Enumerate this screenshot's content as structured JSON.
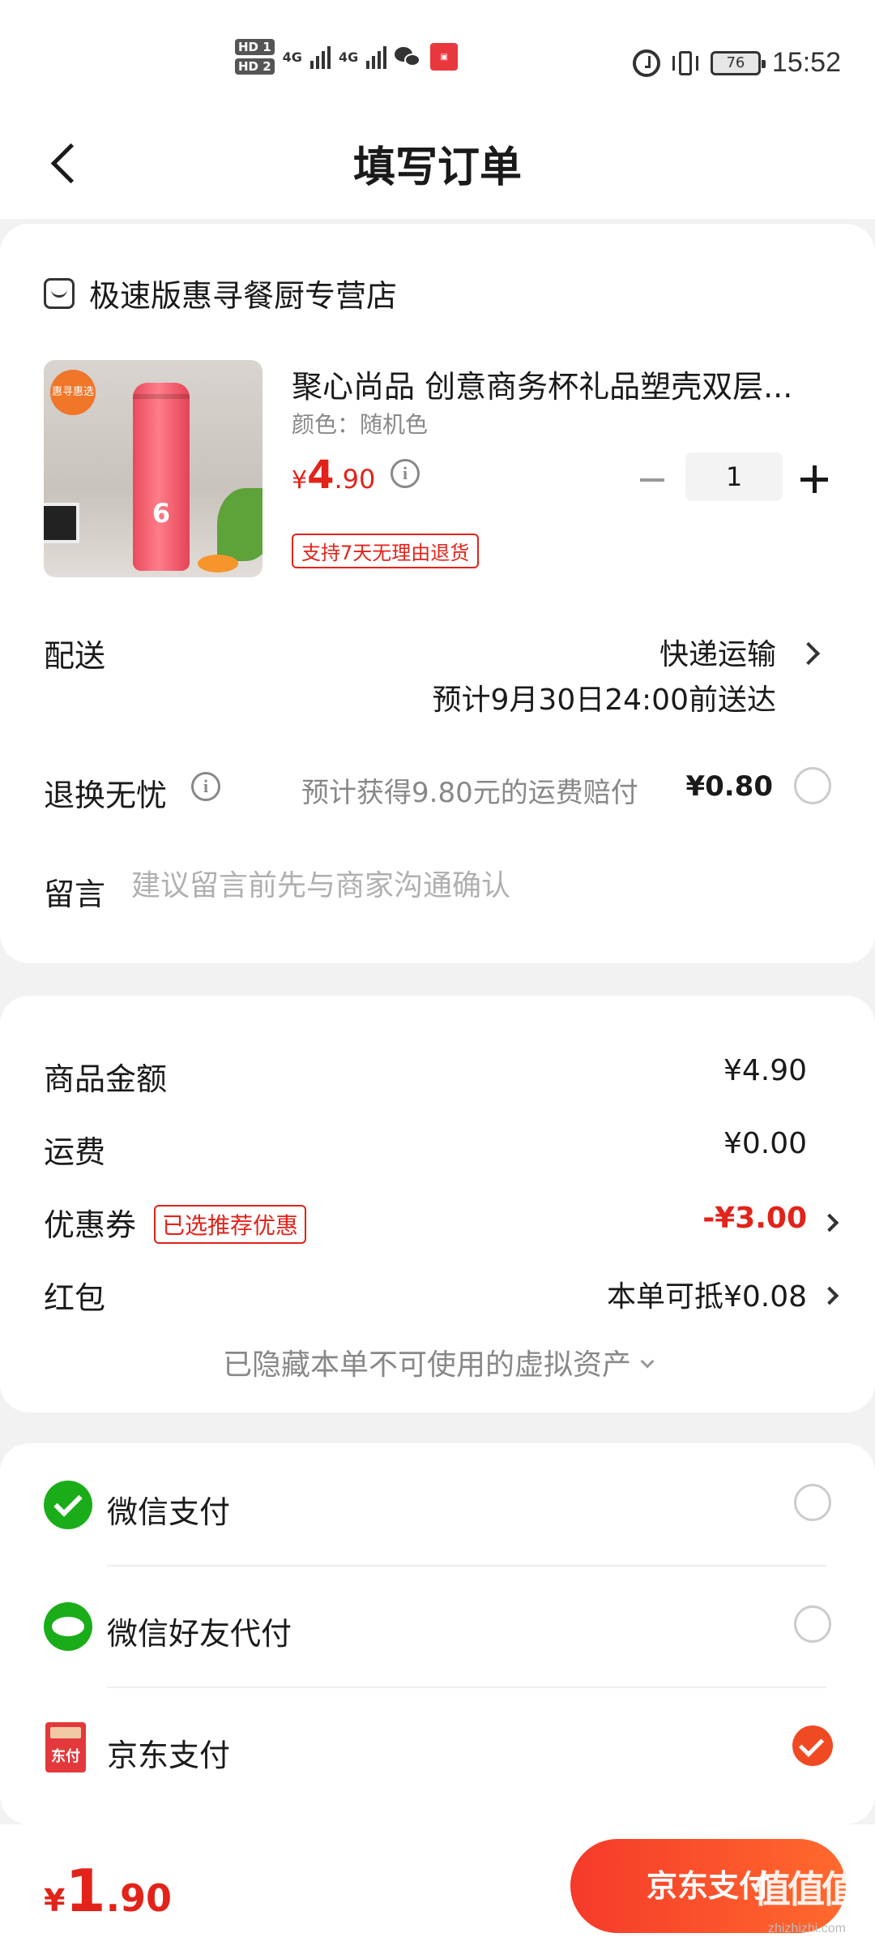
{
  "status_bar": {
    "hd1": "HD 1",
    "hd2": "HD 2",
    "net1": "4G",
    "net2": "4G",
    "battery": "76",
    "time": "15:52"
  },
  "header": {
    "title": "填写订单",
    "back_icon": "chevron-left-icon"
  },
  "store": {
    "name": "极速版惠寻餐厨专营店"
  },
  "product": {
    "title": "聚心尚品 创意商务杯礼品塑壳双层...",
    "variant": "颜色：随机色",
    "price_currency": "¥",
    "price_int": "4",
    "price_dec": ".90",
    "image_badge": "惠寻惠选",
    "quantity": "1",
    "return_policy": "支持7天无理由退货"
  },
  "shipping": {
    "label": "配送",
    "method": "快递运输",
    "eta": "预计9月30日24:00前送达"
  },
  "insurance": {
    "label": "退换无忧",
    "description": "预计获得9.80元的运费赔付",
    "price": "¥0.80",
    "checked": false
  },
  "message": {
    "label": "留言",
    "placeholder": "建议留言前先与商家沟通确认"
  },
  "summary": {
    "goods_label": "商品金额",
    "goods_value": "¥4.90",
    "shipping_label": "运费",
    "shipping_value": "¥0.00",
    "coupon_label": "优惠券",
    "coupon_tag": "已选推荐优惠",
    "coupon_value": "-¥3.00",
    "redpacket_label": "红包",
    "redpacket_value": "本单可抵¥0.08",
    "hidden_assets": "已隐藏本单不可使用的虚拟资产"
  },
  "payment_methods": [
    {
      "name": "微信支付",
      "icon": "wechat-pay-icon",
      "selected": false
    },
    {
      "name": "微信好友代付",
      "icon": "wechat-friend-pay-icon",
      "selected": false
    },
    {
      "name": "京东支付",
      "icon": "jd-pay-icon",
      "selected": true,
      "icon_text": "东付"
    }
  ],
  "bottom_bar": {
    "total_currency": "¥",
    "total_int": "1",
    "total_dec": ".90",
    "pay_button": "京东支付",
    "watermark": "值值值",
    "watermark_sub": "zhizhizhi.com"
  },
  "colors": {
    "accent": "#e2231a",
    "pay_button_start": "#f53a2a",
    "pay_button_end": "#ff6a2d",
    "wechat_green": "#1aad19",
    "jd_red": "#e4393c",
    "background": "#f2f2f2"
  }
}
